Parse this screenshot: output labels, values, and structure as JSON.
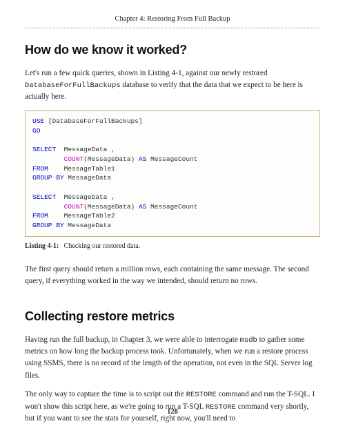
{
  "header": {
    "chapter_title": "Chapter 4: Restoring From Full Backup"
  },
  "section1": {
    "heading": "How do we know it worked?",
    "para1_pre": "Let's run a few quick queries, shown in Listing 4-1, against our newly restored ",
    "para1_db": "DatabaseForFullBackups",
    "para1_post": " database to verify that the data that we expect to be here is actually here."
  },
  "code": {
    "l01a": "USE",
    "l01b": " [DatabaseForFullBackups]",
    "l02": "GO",
    "l03": "",
    "l04a": "SELECT",
    "l04b": "  MessageData ,",
    "l05a": "        ",
    "l05b": "COUNT",
    "l05c": "(MessageData) ",
    "l05d": "AS",
    "l05e": " MessageCount",
    "l06a": "FROM",
    "l06b": "    MessageTable1",
    "l07a": "GROUP BY",
    "l07b": " MessageData",
    "l08": "",
    "l09a": "SELECT",
    "l09b": "  MessageData ,",
    "l10a": "        ",
    "l10b": "COUNT",
    "l10c": "(MessageData) ",
    "l10d": "AS",
    "l10e": " MessageCount",
    "l11a": "FROM",
    "l11b": "    MessageTable2",
    "l12a": "GROUP BY",
    "l12b": " MessageData"
  },
  "listing": {
    "label": "Listing 4-1:",
    "caption": "Checking our restored data."
  },
  "section1_after": {
    "para2": "The first query should return a million rows, each containing the same message. The second query, if everything worked in the way we intended, should return no rows."
  },
  "section2": {
    "heading": "Collecting restore metrics",
    "para1_pre": "Having run the full backup, in Chapter 3, we were able to interrogate ",
    "para1_msdb": "msdb",
    "para1_post": " to gather some metrics on how long the backup process took. Unfortunately, when we run a restore process using SSMS, there is no record of the length of the operation, not even in the SQL Server log files.",
    "para2_pre": "The only way to capture the time is to script out the ",
    "para2_restore1": "RESTORE",
    "para2_mid": " command and run the T-SQL. I won't show this script here, as we're going to run a T-SQL ",
    "para2_restore2": "RESTORE",
    "para2_post": " command very shortly, but if you want to see the stats for yourself, right now, you'll need to"
  },
  "page": {
    "number": "128"
  }
}
